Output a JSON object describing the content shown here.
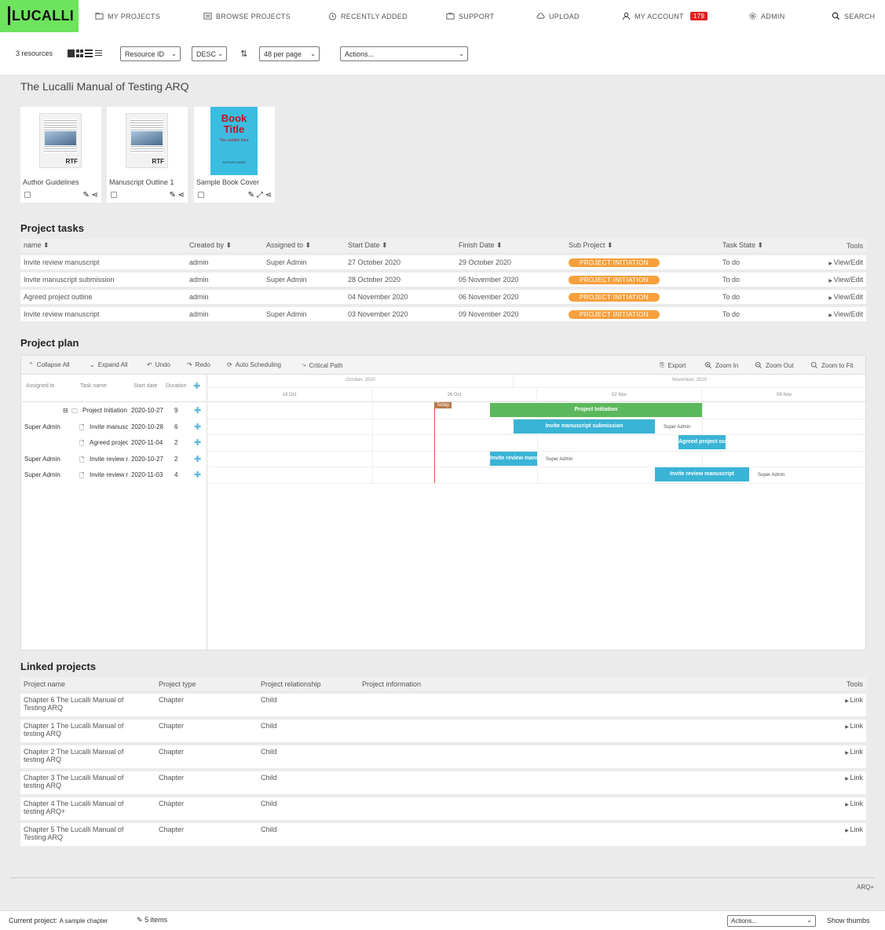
{
  "header": {
    "logo": "LUCALLI",
    "nav": [
      {
        "label": "MY PROJECTS",
        "icon": "folder-icon"
      },
      {
        "label": "BROWSE PROJECTS",
        "icon": "list-icon"
      },
      {
        "label": "RECENTLY ADDED",
        "icon": "clock-icon"
      },
      {
        "label": "SUPPORT",
        "icon": "support-icon"
      },
      {
        "label": "UPLOAD",
        "icon": "upload-icon"
      },
      {
        "label": "MY ACCOUNT",
        "icon": "user-icon",
        "badge": "179"
      },
      {
        "label": "ADMIN",
        "icon": "gear-icon"
      },
      {
        "label": "SEARCH",
        "icon": "search-icon"
      }
    ]
  },
  "toolbar": {
    "count": "3 resources",
    "sort": "Resource ID",
    "order": "DESC",
    "per_page": "48 per page",
    "actions": "Actions..."
  },
  "page_title": "The Lucalli Manual of Testing ARQ",
  "resources": [
    {
      "label": "Author Guidelines",
      "type": "RTF"
    },
    {
      "label": "Manuscript Outline 1",
      "type": "RTF"
    },
    {
      "label": "Sample Book Cover",
      "cover_title": "Book Title",
      "cover_sub": "The subtitle here",
      "cover_author": "AUTHOR NAME"
    }
  ],
  "tasks": {
    "title": "Project tasks",
    "headers": [
      "name",
      "Created by",
      "Assigned to",
      "Start Date",
      "Finish Date",
      "Sub Project",
      "Task State",
      "Tools"
    ],
    "rows": [
      [
        "Invite review manuscript",
        "admin",
        "Super Admin",
        "27 October 2020",
        "29 October 2020",
        "PROJECT INITIATION",
        "To do",
        "View/Edit"
      ],
      [
        "Invite manuscript submission",
        "admin",
        "Super Admin",
        "28 October 2020",
        "05 November 2020",
        "PROJECT INITIATION",
        "To do",
        "View/Edit"
      ],
      [
        "Agreed project outline",
        "admin",
        "",
        "04 November 2020",
        "06 November 2020",
        "PROJECT INITIATION",
        "To do",
        "View/Edit"
      ],
      [
        "Invite review manuscript",
        "admin",
        "Super Admin",
        "03 November 2020",
        "09 November 2020",
        "PROJECT INITIATION",
        "To do",
        "View/Edit"
      ]
    ]
  },
  "plan": {
    "title": "Project plan",
    "buttons": {
      "collapse": "Collapse All",
      "expand": "Expand All",
      "undo": "Undo",
      "redo": "Redo",
      "auto": "Auto Scheduling",
      "critical": "Critical Path",
      "export": "Export",
      "zoom_in": "Zoom In",
      "zoom_out": "Zoom Out",
      "zoom_fit": "Zoom to Fit"
    },
    "grid_headers": [
      "Assigned to",
      "Task name",
      "Start date",
      "Duration"
    ],
    "months": [
      "October, 2020",
      "November, 2020"
    ],
    "weeks": [
      "19 Oct",
      "26 Oct",
      "02 Nov",
      "09 Nov"
    ],
    "today": "Today",
    "rows": [
      {
        "assigned": "",
        "name": "Project Initiation",
        "start": "2020-10-27",
        "dur": "9"
      },
      {
        "assigned": "Super Admin",
        "name": "Invite manuscr",
        "start": "2020-10-28",
        "dur": "6"
      },
      {
        "assigned": "",
        "name": "Agreed project",
        "start": "2020-11-04",
        "dur": "2"
      },
      {
        "assigned": "Super Admin",
        "name": "Invite review m",
        "start": "2020-10-27",
        "dur": "2"
      },
      {
        "assigned": "Super Admin",
        "name": "Invite review m",
        "start": "2020-11-03",
        "dur": "4"
      }
    ],
    "bars": [
      {
        "label": "Project Initiation",
        "owner": "",
        "color": "#5cb85c"
      },
      {
        "label": "Invite manuscript submission",
        "owner": "Super Admin",
        "color": "#3ab4d6"
      },
      {
        "label": "Agreed project outl",
        "owner": "",
        "color": "#3ab4d6"
      },
      {
        "label": "Invite review manu",
        "owner": "Super Admin",
        "color": "#3ab4d6"
      },
      {
        "label": "Invite review manuscript",
        "owner": "Super Admin",
        "color": "#3ab4d6"
      }
    ]
  },
  "linked": {
    "title": "Linked projects",
    "headers": [
      "Project name",
      "Project type",
      "Project relationship",
      "Project information",
      "Tools"
    ],
    "rows": [
      [
        "Chapter 6 The Lucalli Manual of",
        "Testing ARQ",
        "Chapter",
        "Child",
        "Link"
      ],
      [
        "Chapter 1 The Lucalli Manual of",
        "testing ARQ",
        "Chapter",
        "Child",
        "Link"
      ],
      [
        "Chapter 2 The Lucalli Manual of",
        "testing ARQ",
        "Chapter",
        "Child",
        "Link"
      ],
      [
        "Chapter 3 The Lucalli Manual of",
        "testing ARQ",
        "Chapter",
        "Child",
        "Link"
      ],
      [
        "Chapter 4 The Lucalli Manual of",
        "testing ARQ+",
        "Chapter",
        "Child",
        "Link"
      ],
      [
        "Chapter 5 The Lucalli Manual of",
        "Testing ARQ",
        "Chapter",
        "Child",
        "Link"
      ]
    ]
  },
  "footer": {
    "brand": "ARQ+"
  },
  "status": {
    "label": "Current project:",
    "project": "A sample chapter",
    "items": "5 items",
    "actions": "Actions...",
    "thumbs": "Show thumbs"
  }
}
